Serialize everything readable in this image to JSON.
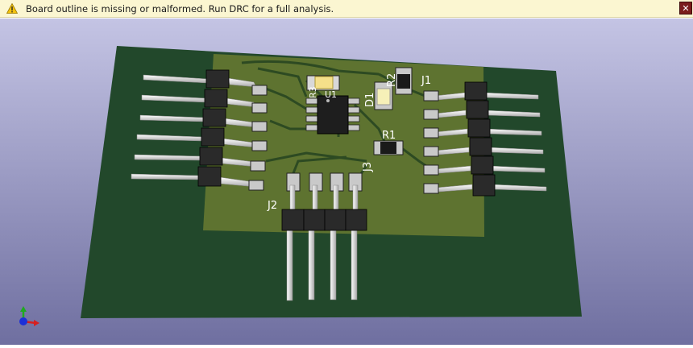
{
  "infobar": {
    "message": "Board outline is missing or malformed. Run DRC for a full analysis.",
    "close_label": "✕"
  },
  "labels": {
    "j1": "J1",
    "j2": "J2",
    "j3": "J3",
    "r1": "R1",
    "r2": "R2",
    "d1": "D1",
    "u1": "U1",
    "r3": "R3"
  },
  "colors": {
    "warning": "#f4c20d",
    "background_top": "#c4c4e4",
    "background_bottom": "#6f6fa0",
    "board": "#22482b",
    "copper": "#5e7330",
    "trace": "#2d4a22",
    "pad": "#c9c9c9"
  },
  "icons": {
    "warning": "warning-icon",
    "close": "close-icon",
    "axes": "axis-gizmo-icon"
  }
}
